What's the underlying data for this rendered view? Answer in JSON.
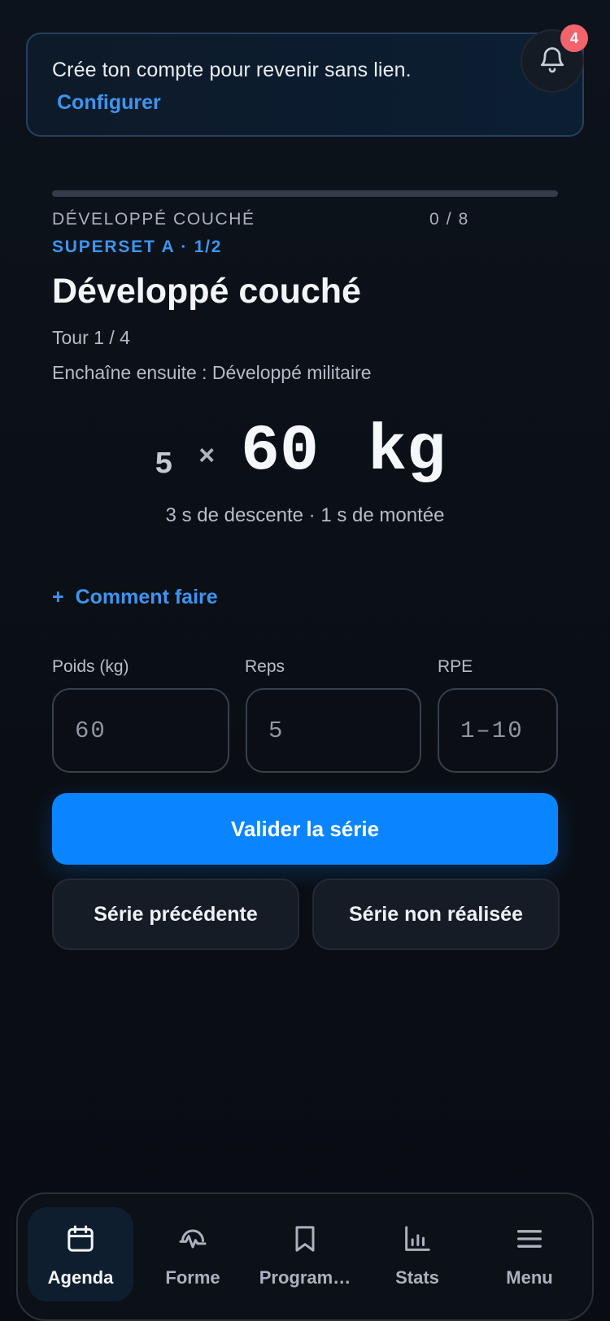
{
  "banner": {
    "text": "Crée ton compte pour revenir sans lien.",
    "link_label": "Configurer"
  },
  "notifications": {
    "icon": "bell-icon",
    "count": "4"
  },
  "workout": {
    "progress_fraction": 0,
    "exercise_caption": "DÉVELOPPÉ COUCHÉ",
    "progress_count": "0 / 8",
    "superset": "SUPERSET A · 1/2",
    "title": "Développé couché",
    "tour": "Tour 1 / 4",
    "next": "Enchaîne ensuite : Développé militaire",
    "reps": "5",
    "times": "×",
    "weight": "60",
    "unit": "kg",
    "tempo": "3 s de descente · 1 s de montée",
    "howto_plus": "+",
    "howto_label": "Comment faire"
  },
  "form": {
    "weight_label": "Poids (kg)",
    "weight_placeholder": "60",
    "reps_label": "Reps",
    "reps_placeholder": "5",
    "rpe_label": "RPE",
    "rpe_placeholder": "1–10"
  },
  "actions": {
    "validate": "Valider la série",
    "previous": "Série précédente",
    "skip": "Série non réalisée"
  },
  "nav": {
    "items": [
      {
        "label": "Agenda",
        "icon": "calendar-icon",
        "active": true
      },
      {
        "label": "Forme",
        "icon": "heart-pulse-icon",
        "active": false
      },
      {
        "label": "Program…",
        "icon": "bookmark-icon",
        "active": false
      },
      {
        "label": "Stats",
        "icon": "bar-chart-icon",
        "active": false
      },
      {
        "label": "Menu",
        "icon": "menu-icon",
        "active": false
      }
    ]
  },
  "colors": {
    "accent": "#0a84ff",
    "link": "#3e95ef",
    "badge": "#f2636b",
    "background": "#0b0f16"
  }
}
